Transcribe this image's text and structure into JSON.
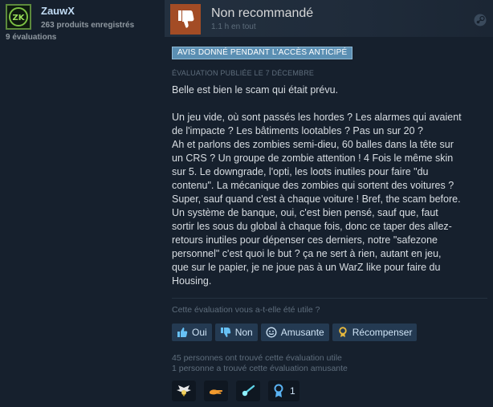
{
  "author": {
    "name": "ZauwX",
    "avatar_text": "ZK",
    "products": "263 produits enregistrés",
    "reviews": "9 évaluations"
  },
  "review": {
    "verdict": "Non recommandé",
    "hours": "1.1 h en tout",
    "early_access_badge": "AVIS DONNÉ PENDANT L'ACCÈS ANTICIPÉ",
    "posted": "ÉVALUATION PUBLIÉE LE 7 DÉCEMBRE",
    "body": "Belle est bien le scam qui était prévu.\n\nUn jeu vide, où sont passés les hordes ? Les alarmes qui avaient\nde l'impacte ? Les bâtiments lootables ? Pas un sur 20 ?\nAh et parlons des zombies semi-dieu, 60 balles dans la tête sur\nun CRS ? Un groupe de zombie attention ! 4 Fois le même skin\nsur 5. Le downgrade, l'opti, les loots inutiles pour faire \"du\ncontenu\". La mécanique des zombies qui sortent des voitures ?\nSuper, sauf quand c'est à chaque voiture ! Bref, the scam before.\nUn système de banque, oui, c'est bien pensé, sauf que, faut\nsortir les sous du global à chaque fois, donc ce taper des allez-\nretours inutiles pour dépenser ces derniers, notre \"safezone\npersonnel\" c'est quoi le but ? ça ne sert à rien, autant en jeu,\nque sur le papier, je ne joue pas à un WarZ like pour faire du\nHousing.",
    "helpful_question": "Cette évaluation vous a-t-elle été utile ?",
    "buttons": {
      "yes": "Oui",
      "no": "Non",
      "funny": "Amusante",
      "award": "Récompenser"
    },
    "stats": {
      "helpful": "45 personnes ont trouvé cette évaluation utile",
      "funny": "1 personne a trouvé cette évaluation amusante"
    },
    "awards": [
      {
        "icon": "winged-award-icon",
        "count": ""
      },
      {
        "icon": "hand-award-icon",
        "count": ""
      },
      {
        "icon": "comet-award-icon",
        "count": ""
      },
      {
        "icon": "medal-award-icon",
        "count": "1"
      }
    ]
  },
  "colors": {
    "background": "#16202d",
    "thumb_down_bg": "#a34c25",
    "badge_bg": "#5b8fb3",
    "button_bg": "#243a52"
  }
}
